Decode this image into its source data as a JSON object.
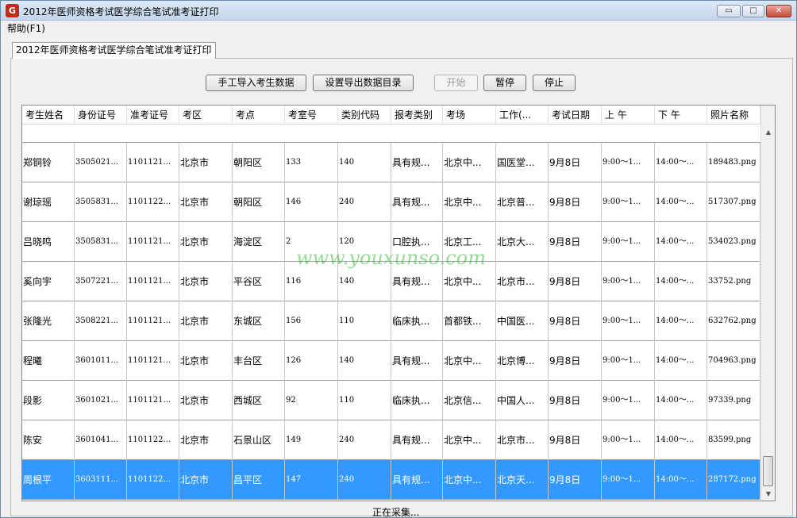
{
  "window": {
    "title": "2012年医师资格考试医学综合笔试准考证打印",
    "icon": "app-logo-icon",
    "controls": {
      "minimize": "▭",
      "maximize": "□",
      "close": "✕"
    }
  },
  "menu": {
    "help": "帮助(F1)"
  },
  "tab": {
    "label": "2012年医师资格考试医学综合笔试准考证打印"
  },
  "toolbar": {
    "import": "手工导入考生数据",
    "export_dir": "设置导出数据目录",
    "start": "开始",
    "pause": "暂停",
    "stop": "停止"
  },
  "table": {
    "columns": [
      "考生姓名",
      "身份证号",
      "准考证号",
      "考区",
      "考点",
      "考室号",
      "类别代码",
      "报考类别",
      "考场",
      "工作(...",
      "考试日期",
      "上 午",
      "下 午",
      "照片名称"
    ],
    "rows": [
      [
        "郑铜铃",
        "3505021...",
        "1101121...",
        "北京市",
        "朝阳区",
        "133",
        "140",
        "具有规...",
        "北京中...",
        "国医堂...",
        "9月8日",
        "9:00～1...",
        "14:00～...",
        "189483.png"
      ],
      [
        "谢琼瑶",
        "3505831...",
        "1101122...",
        "北京市",
        "朝阳区",
        "146",
        "240",
        "具有规...",
        "北京中...",
        "北京普...",
        "9月8日",
        "9:00～1...",
        "14:00～...",
        "517307.png"
      ],
      [
        "吕晓鸣",
        "3505831...",
        "1101121...",
        "北京市",
        "海淀区",
        "2",
        "120",
        "口腔执...",
        "北京工...",
        "北京大...",
        "9月8日",
        "9:00～1...",
        "14:00～...",
        "534023.png"
      ],
      [
        "奚向宇",
        "3507221...",
        "1101121...",
        "北京市",
        "平谷区",
        "116",
        "140",
        "具有规...",
        "北京中...",
        "北京市...",
        "9月8日",
        "9:00～1...",
        "14:00～...",
        "33752.png"
      ],
      [
        "张隆光",
        "3508221...",
        "1101121...",
        "北京市",
        "东城区",
        "156",
        "110",
        "临床执...",
        "首都铁...",
        "中国医...",
        "9月8日",
        "9:00～1...",
        "14:00～...",
        "632762.png"
      ],
      [
        "程曦",
        "3601011...",
        "1101121...",
        "北京市",
        "丰台区",
        "126",
        "140",
        "具有规...",
        "北京中...",
        "北京博...",
        "9月8日",
        "9:00～1...",
        "14:00～...",
        "704963.png"
      ],
      [
        "段影",
        "3601021...",
        "1101121...",
        "北京市",
        "西城区",
        "92",
        "110",
        "临床执...",
        "北京信...",
        "中国人...",
        "9月8日",
        "9:00～1...",
        "14:00～...",
        "97339.png"
      ],
      [
        "陈安",
        "3601041...",
        "1101122...",
        "北京市",
        "石景山区",
        "149",
        "240",
        "具有规...",
        "北京中...",
        "北京市...",
        "9月8日",
        "9:00～1...",
        "14:00～...",
        "83599.png"
      ],
      [
        "周根平",
        "3603111...",
        "1101122...",
        "北京市",
        "昌平区",
        "147",
        "240",
        "具有规...",
        "北京中...",
        "北京天...",
        "9月8日",
        "9:00～1...",
        "14:00～...",
        "287172.png"
      ]
    ],
    "selected_row": 8
  },
  "watermark": "www.youxunso.com",
  "status": "正在采集..."
}
